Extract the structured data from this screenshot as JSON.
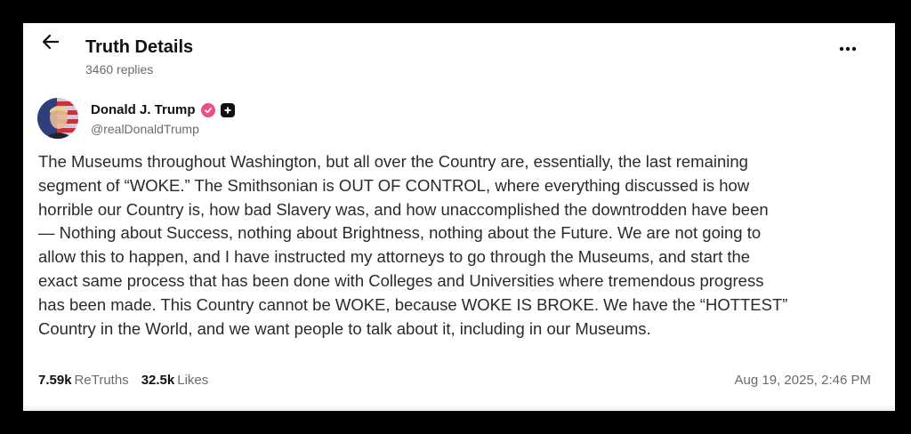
{
  "header": {
    "title": "Truth Details",
    "replies": "3460 replies"
  },
  "author": {
    "name": "Donald J. Trump",
    "handle": "@realDonaldTrump"
  },
  "post": {
    "lines": [
      "The Museums throughout Washington, but all over the Country are, essentially, the last remaining",
      "segment of “WOKE.” The Smithsonian is OUT OF CONTROL, where everything discussed is how",
      "horrible our Country is, how bad Slavery was, and how unaccomplished the downtrodden have been",
      "— Nothing about Success, nothing about Brightness, nothing about the Future. We are not going to",
      "allow this to happen, and I have instructed my attorneys to go through the Museums, and start the",
      "exact same process that has been done with Colleges and Universities where tremendous progress",
      "has been made. This Country cannot be WOKE, because WOKE IS BROKE. We have the “HOTTEST”",
      "Country in the World, and we want people to talk about it, including in our Museums."
    ]
  },
  "stats": {
    "retruths_count": "7.59k",
    "retruths_label": "ReTruths",
    "likes_count": "32.5k",
    "likes_label": "Likes",
    "date": "Aug 19, 2025, 2:46 PM"
  },
  "icons": {
    "back": "arrow-left-icon",
    "more": "more-horizontal-icon",
    "verified": "verified-badge-icon",
    "plus": "plus-badge-icon"
  },
  "colors": {
    "verified": "#ee4e86",
    "muted": "#6b6b6b"
  }
}
